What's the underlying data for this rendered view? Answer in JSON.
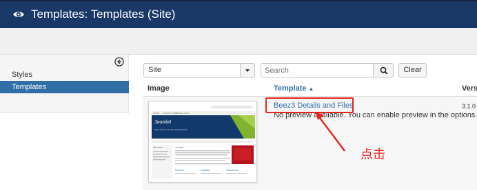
{
  "header": {
    "title": "Templates: Templates (Site)",
    "icon": "eye-icon"
  },
  "sidebar": {
    "items": [
      {
        "label": "Styles",
        "active": false
      },
      {
        "label": "Templates",
        "active": true
      }
    ]
  },
  "filters": {
    "client_select_value": "Site",
    "search_placeholder": "Search",
    "clear_label": "Clear"
  },
  "table": {
    "headers": {
      "image": "Image",
      "template": "Template",
      "template_sort": "▲",
      "version": "Versi"
    },
    "rows": [
      {
        "template_link": "Beez3 Details and Files",
        "preview_note": "No preview available. You can enable preview in the options.",
        "version": "3.1.0"
      }
    ]
  },
  "thumbnail": {
    "nav": [
      "HOME",
      "SAMPLE SITES",
      "JOOMLA.ORG"
    ],
    "brand": "Joomla!",
    "tagline": "Open Source Content Management",
    "sidebar_heading": "Main Menu",
    "content_heading": "Joomla!",
    "columns": [
      "Beginners",
      "Upgraders",
      "Professionals"
    ]
  },
  "annotation": {
    "text": "点击",
    "color": "#e8231b"
  },
  "colors": {
    "header_bg": "#1a3867",
    "active_item": "#2f6ea6",
    "link": "#2f6ea6"
  }
}
